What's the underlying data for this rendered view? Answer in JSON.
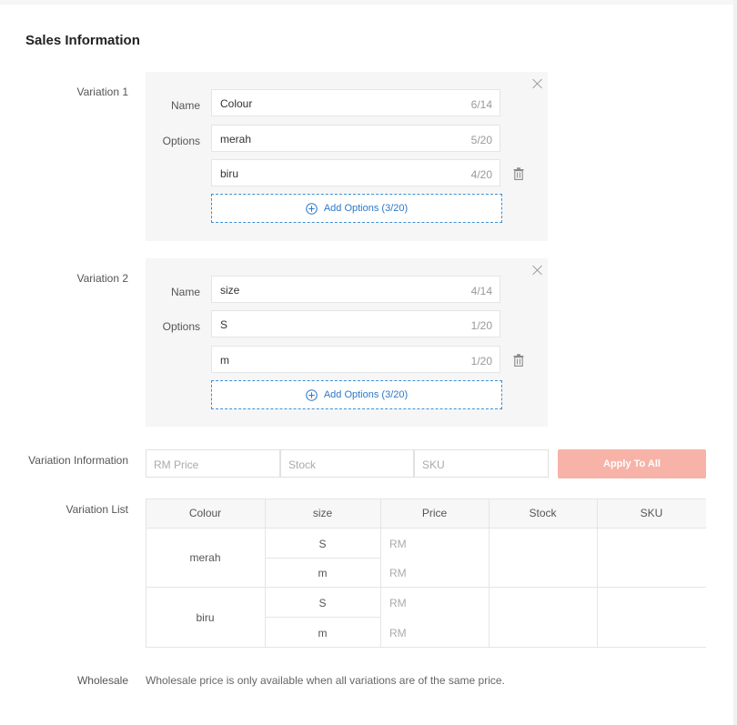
{
  "section": {
    "title": "Sales Information"
  },
  "variation1": {
    "label": "Variation 1",
    "name_label": "Name",
    "options_label": "Options",
    "name_value": "Colour",
    "name_count": "6/14",
    "options": [
      {
        "value": "merah",
        "count": "5/20"
      },
      {
        "value": "biru",
        "count": "4/20"
      }
    ],
    "add_label": "Add Options (3/20)"
  },
  "variation2": {
    "label": "Variation 2",
    "name_label": "Name",
    "options_label": "Options",
    "name_value": "size",
    "name_count": "4/14",
    "options": [
      {
        "value": "S",
        "count": "1/20"
      },
      {
        "value": "m",
        "count": "1/20"
      }
    ],
    "add_label": "Add Options (3/20)"
  },
  "variation_info": {
    "label": "Variation Information",
    "price_placeholder": "RM Price",
    "stock_placeholder": "Stock",
    "sku_placeholder": "SKU",
    "apply_label": "Apply To All"
  },
  "variation_list": {
    "label": "Variation List",
    "headers": [
      "Colour",
      "size",
      "Price",
      "Stock",
      "SKU"
    ],
    "groups": [
      {
        "colour": "merah",
        "rows": [
          {
            "size": "S",
            "price": "RM"
          },
          {
            "size": "m",
            "price": "RM"
          }
        ]
      },
      {
        "colour": "biru",
        "rows": [
          {
            "size": "S",
            "price": "RM"
          },
          {
            "size": "m",
            "price": "RM"
          }
        ]
      }
    ]
  },
  "wholesale": {
    "label": "Wholesale",
    "message": "Wholesale price is only available when all variations are of the same price."
  },
  "colors": {
    "accent_blue": "#2d78c7",
    "apply_disabled": "#f7b3a8",
    "panel_bg": "#f6f6f6"
  }
}
